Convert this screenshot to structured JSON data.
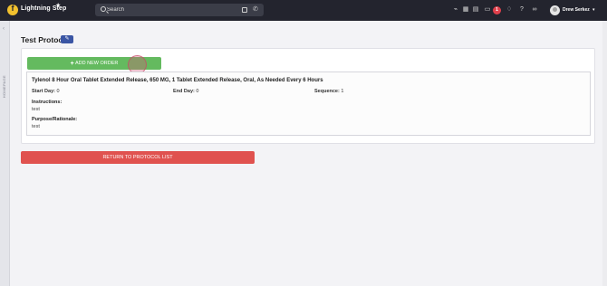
{
  "app": {
    "brand": "Lightning Step",
    "logo_glyph": "f"
  },
  "topbar": {
    "search_placeholder": "Search",
    "notification_count": "1",
    "user_name": "Drew Serkez",
    "icons": [
      "megaphone-icon",
      "calendar-icon",
      "grid-icon",
      "chat-icon",
      "bell-icon",
      "help-icon",
      "link-icon"
    ]
  },
  "sidebar": {
    "label": "HOMEPAGE"
  },
  "page": {
    "title": "Test Protocol",
    "add_order_label": "ADD NEW ORDER",
    "return_label": "RETURN TO PROTOCOL LIST"
  },
  "order": {
    "title": "Tylenol 8 Hour Oral Tablet Extended Release, 650 MG, 1 Tablet Extended Release, Oral, As Needed Every 6 Hours",
    "start_day_label": "Start Day:",
    "start_day": "0",
    "end_day_label": "End Day:",
    "end_day": "0",
    "sequence_label": "Sequence:",
    "sequence": "1",
    "instructions_label": "Instructions:",
    "instructions": "test",
    "purpose_label": "Purpose/Rationale:",
    "purpose": "test"
  },
  "colors": {
    "navbar": "#23242e",
    "add_button": "#64ba5f",
    "return_button": "#e0524f",
    "edit_button": "#3a55a4",
    "badge": "#e0404c"
  }
}
